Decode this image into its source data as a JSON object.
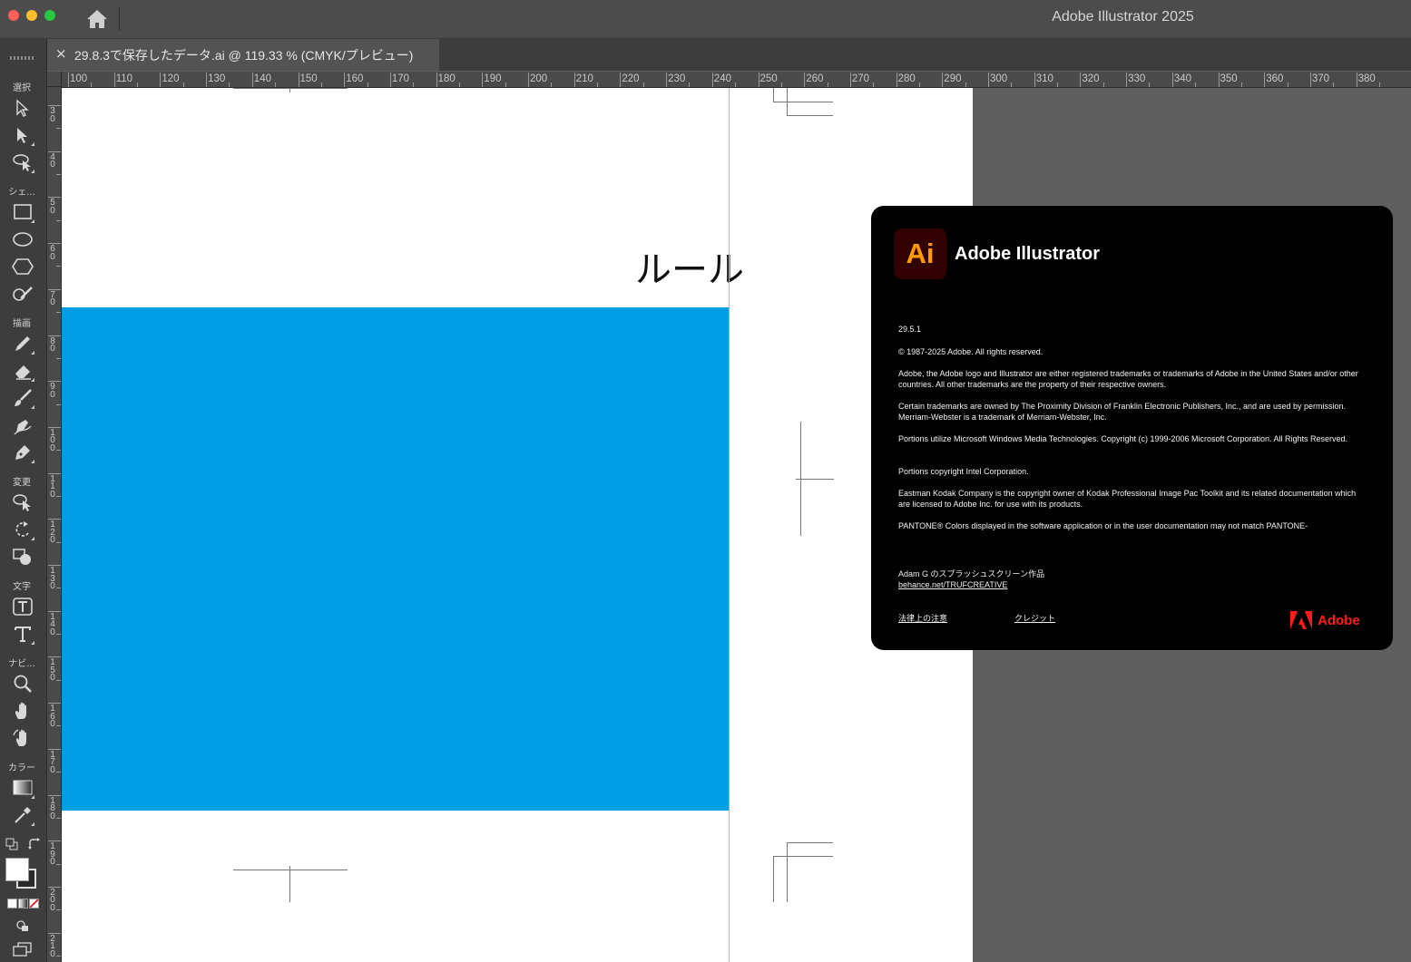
{
  "window": {
    "app_title": "Adobe Illustrator 2025",
    "traffic_lights": {
      "close": "#fe5f57",
      "minimize": "#febc2e",
      "zoom": "#28c840"
    }
  },
  "document_tab": {
    "close_glyph": "×",
    "title": "29.8.3で保存したデータ.ai @ 119.33 % (CMYK/プレビュー)"
  },
  "toolbar": {
    "collapse_glyph": "››",
    "groups": {
      "select": "選択",
      "shape": "シェ...",
      "draw": "描画",
      "transform": "変更",
      "type": "文字",
      "navigate": "ナビ...",
      "color": "カラー"
    }
  },
  "rulers": {
    "horizontal": [
      "100",
      "110",
      "120",
      "130",
      "140",
      "150",
      "160",
      "170",
      "180",
      "190",
      "200",
      "210",
      "220",
      "230",
      "240",
      "250",
      "260",
      "270",
      "280",
      "290",
      "300",
      "310",
      "320",
      "330",
      "340",
      "350",
      "360",
      "370",
      "380"
    ],
    "vertical": [
      "30",
      "40",
      "50",
      "60",
      "70",
      "80",
      "90",
      "100",
      "110",
      "120",
      "130",
      "140",
      "150",
      "160",
      "170",
      "180",
      "190",
      "200",
      "210"
    ]
  },
  "artboard": {
    "text": "ルール",
    "fill_color": "#009ee3",
    "guide_color": "#3ee6e6"
  },
  "splash": {
    "logo_text": "Ai",
    "product_name": "Adobe Illustrator",
    "version": "29.5.1",
    "copyright": "© 1987-2025 Adobe. All rights reserved.",
    "trademark": "Adobe, the Adobe logo and Illustrator are either registered trademarks or trademarks of Adobe in the United States and/or other countries. All other trademarks are the property of their respective owners.",
    "proximity": "Certain trademarks are owned by The Proximity Division of Franklin Electronic Publishers, Inc., and are used by permission. Merriam-Webster is a trademark of Merriam-Webster, Inc.",
    "microsoft": "Portions utilize Microsoft Windows Media Technologies. Copyright (c) 1999-2006 Microsoft Corporation. All Rights Reserved.",
    "intel": "Portions copyright Intel Corporation.",
    "kodak": "Eastman Kodak Company is the copyright owner of Kodak Professional Image Pac Toolkit and its related documentation which are licensed to Adobe Inc. for use with its products.",
    "pantone": "PANTONE® Colors displayed in the software application or in the user documentation may not match PANTONE-",
    "splash_credit": "Adam G のスプラッシュスクリーン作品",
    "splash_link": "behance.net/TRUFCREATIVE",
    "legal_link": "法律上の注意",
    "credits_link": "クレジット",
    "adobe_brand": "Adobe",
    "logo_bg": "#330000",
    "logo_fg": "#ff9a00",
    "brand_color": "#ff1b17"
  }
}
